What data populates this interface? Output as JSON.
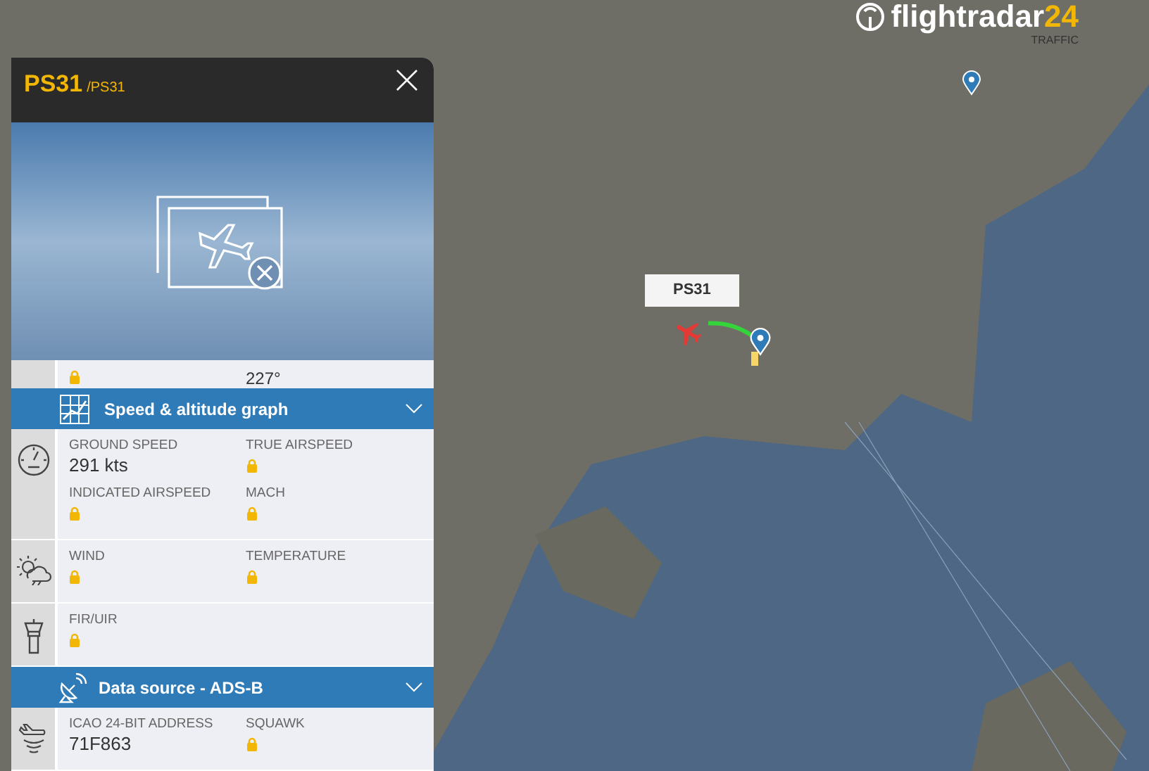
{
  "logo": {
    "name": "flightradar",
    "number": "24",
    "tagline": "TRAFFIC"
  },
  "map": {
    "flight_label": "PS31"
  },
  "panel": {
    "callsign": "PS31",
    "code": "/PS31",
    "cut_row": {
      "locked": true,
      "value": "227°"
    },
    "sections": [
      {
        "kind": "header",
        "title": "Speed & altitude graph",
        "expanded": false
      },
      {
        "kind": "group",
        "fields": [
          {
            "label": "GROUND SPEED",
            "value": "291 kts",
            "locked": false
          },
          {
            "label": "TRUE AIRSPEED",
            "locked": true
          },
          {
            "label": "INDICATED AIRSPEED",
            "locked": true
          },
          {
            "label": "MACH",
            "locked": true
          }
        ]
      },
      {
        "kind": "group",
        "fields": [
          {
            "label": "WIND",
            "locked": true
          },
          {
            "label": "TEMPERATURE",
            "locked": true
          }
        ]
      },
      {
        "kind": "group",
        "fields": [
          {
            "label": "FIR/UIR",
            "locked": true
          }
        ]
      },
      {
        "kind": "header",
        "title": "Data source - ADS-B",
        "expanded": false
      },
      {
        "kind": "group",
        "fields": [
          {
            "label": "ICAO 24-BIT ADDRESS",
            "value": "71F863",
            "locked": false
          },
          {
            "label": "SQUAWK",
            "locked": true
          }
        ]
      }
    ]
  }
}
